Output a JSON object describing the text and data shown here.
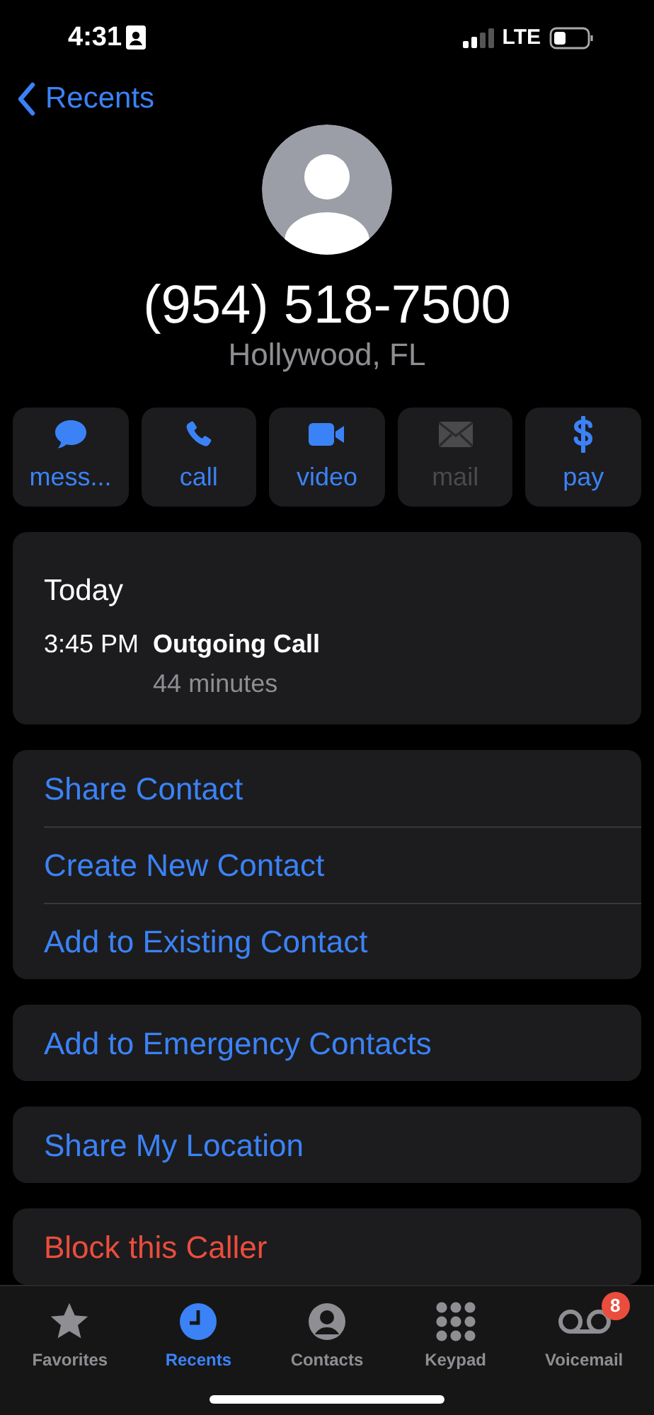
{
  "status_bar": {
    "time": "4:31",
    "network": "LTE"
  },
  "nav": {
    "back_label": "Recents"
  },
  "contact": {
    "number": "(954) 518-7500",
    "location": "Hollywood, FL"
  },
  "actions": [
    {
      "kind": "message",
      "label": "mess...",
      "disabled": false
    },
    {
      "kind": "call",
      "label": "call",
      "disabled": false
    },
    {
      "kind": "video",
      "label": "video",
      "disabled": false
    },
    {
      "kind": "mail",
      "label": "mail",
      "disabled": true
    },
    {
      "kind": "pay",
      "label": "pay",
      "disabled": false
    }
  ],
  "call_history": {
    "day": "Today",
    "entries": [
      {
        "time": "3:45 PM",
        "type": "Outgoing Call",
        "duration": "44 minutes"
      }
    ]
  },
  "groups": [
    [
      {
        "label": "Share Contact",
        "kind": "action"
      },
      {
        "label": "Create New Contact",
        "kind": "action"
      },
      {
        "label": "Add to Existing Contact",
        "kind": "action"
      }
    ],
    [
      {
        "label": "Add to Emergency Contacts",
        "kind": "action"
      }
    ],
    [
      {
        "label": "Share My Location",
        "kind": "action"
      }
    ],
    [
      {
        "label": "Block this Caller",
        "kind": "destructive"
      }
    ]
  ],
  "tab_bar": [
    {
      "kind": "favorites",
      "label": "Favorites",
      "selected": false
    },
    {
      "kind": "recents",
      "label": "Recents",
      "selected": true
    },
    {
      "kind": "contacts",
      "label": "Contacts",
      "selected": false
    },
    {
      "kind": "keypad",
      "label": "Keypad",
      "selected": false
    },
    {
      "kind": "voicemail",
      "label": "Voicemail",
      "selected": false,
      "badge": "8"
    }
  ]
}
